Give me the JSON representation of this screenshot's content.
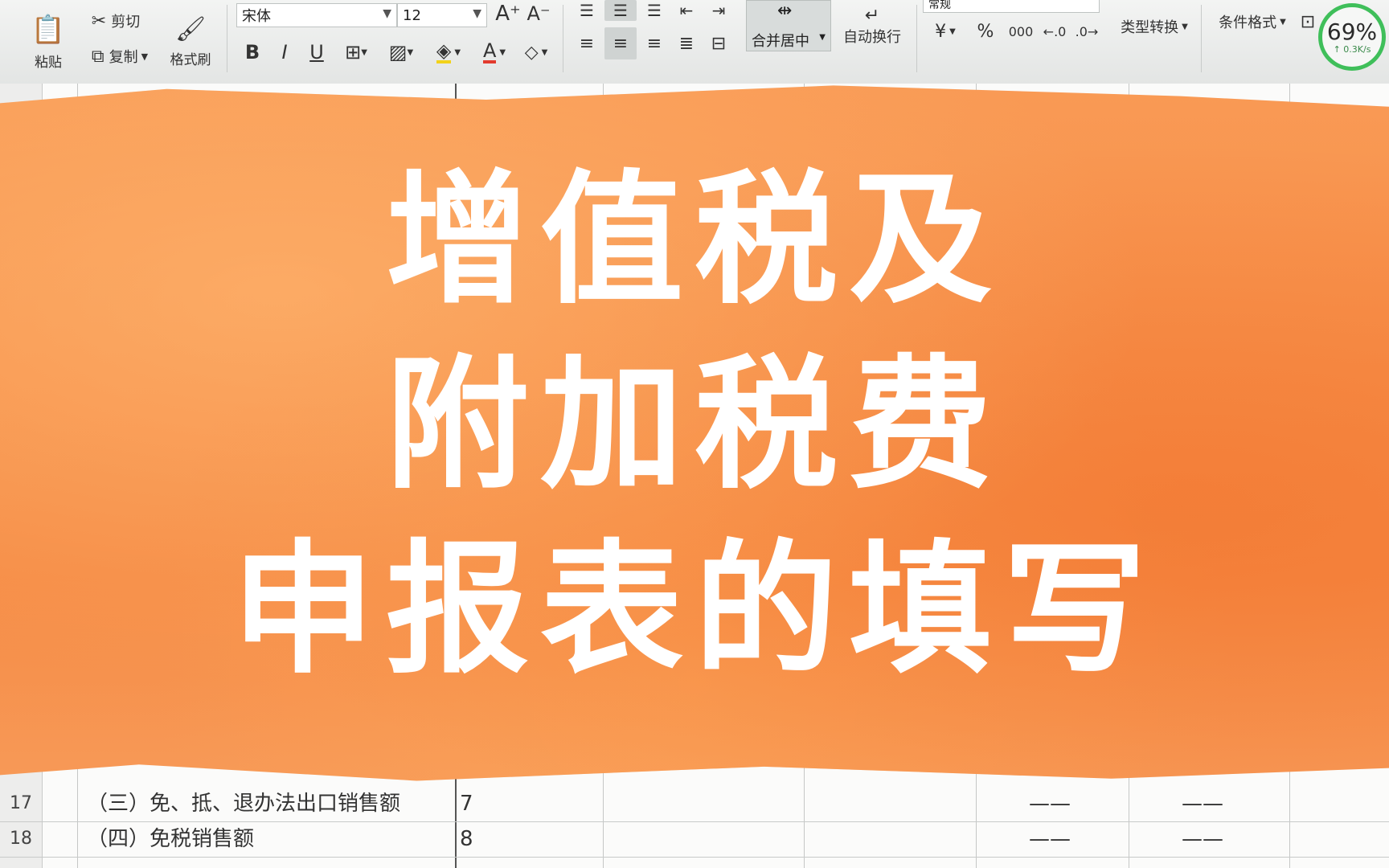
{
  "ribbon": {
    "paste_label": "粘贴",
    "cut_label": "剪切",
    "copy_label": "复制",
    "format_painter_label": "格式刷",
    "font_name": "宋体",
    "font_size": "12",
    "merge_center_label": "合并居中",
    "wrap_text_label": "自动换行",
    "number_format": "常规",
    "currency_symbol": "¥",
    "percent_symbol": "%",
    "thousands_symbol": "000",
    "type_convert_label": "类型转换",
    "conditional_format_label": "条件格式"
  },
  "speed_widget": {
    "percent": "69%",
    "rate": "↑ 0.3K/s"
  },
  "sheet": {
    "rows": [
      {
        "num": "17",
        "label": "（三）免、抵、退办法出口销售额",
        "line": "7",
        "c1": "——",
        "c2": "——"
      },
      {
        "num": "18",
        "label": "（四）免税销售额",
        "line": "8",
        "c1": "——",
        "c2": "——"
      }
    ]
  },
  "banner": {
    "line1": "增值税及",
    "line2": "附加税费",
    "line3": "申报表的填写"
  },
  "colors": {
    "banner_orange": "#f7904a",
    "title_white": "#ffffff",
    "speed_ring": "#3fbf5a"
  }
}
